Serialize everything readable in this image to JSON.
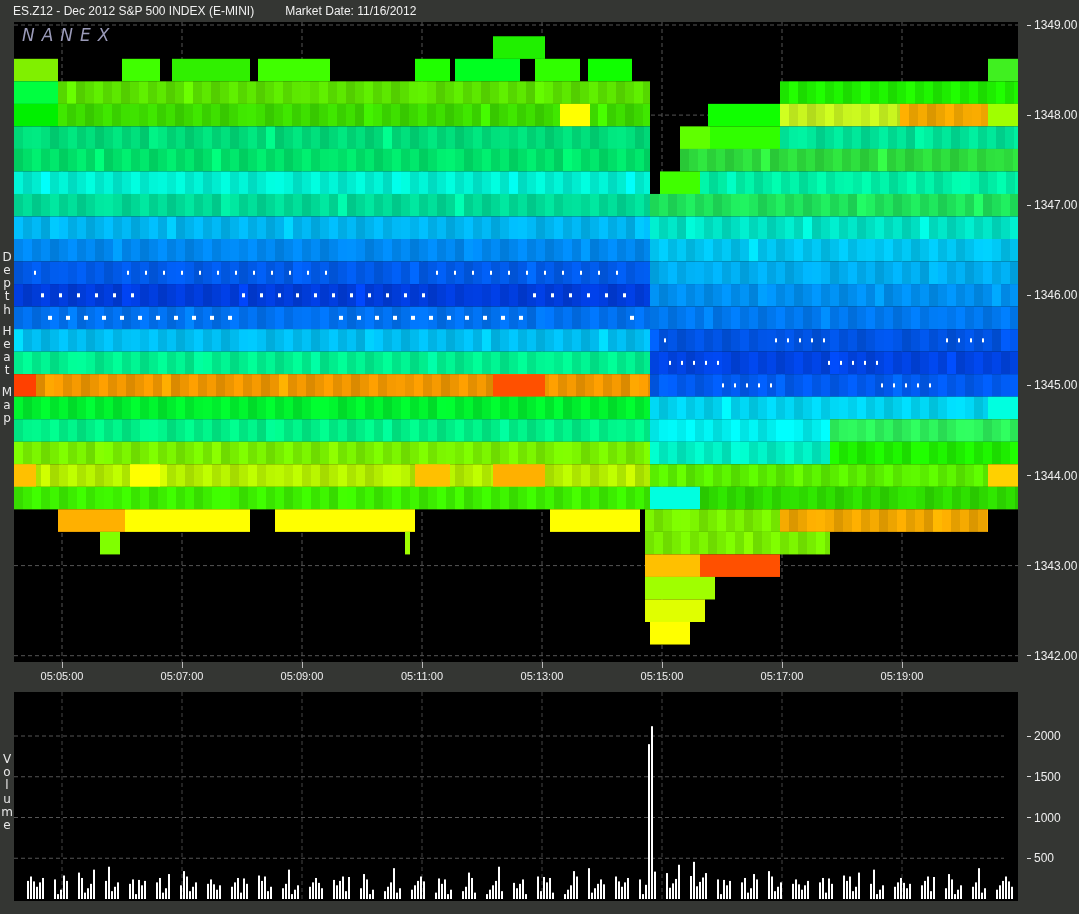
{
  "window": {
    "title": "ES.Z12 - Dec 2012 S&P 500 INDEX (E-MINI)",
    "market_date": "Market Date: 11/16/2012"
  },
  "heat_map": {
    "logo": "NANEX",
    "axis_label": "Depth Heat Map",
    "price_ticks": [
      "1349.00",
      "1348.00",
      "1347.00",
      "1346.00",
      "1345.00",
      "1344.00",
      "1343.00",
      "1342.00"
    ],
    "time_ticks": [
      "05:05:00",
      "05:07:00",
      "05:09:00",
      "05:11:00",
      "05:13:00",
      "05:15:00",
      "05:17:00",
      "05:19:00"
    ]
  },
  "volume_chart": {
    "axis_label": "Volume",
    "volume_ticks": [
      "2000",
      "1500",
      "1000",
      "500"
    ]
  }
}
